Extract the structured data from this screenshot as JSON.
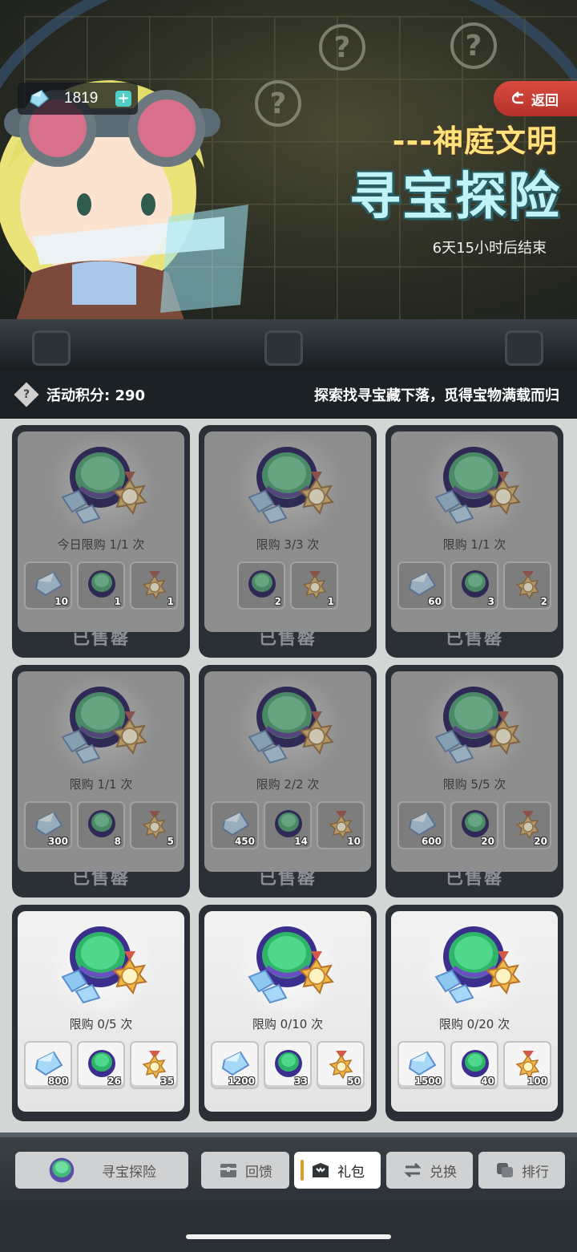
{
  "header": {
    "gem_count": "1819",
    "back_label": "返回",
    "event_subtitle": "---神庭文明",
    "event_title": "寻宝探险",
    "countdown": "6天15小时后结束"
  },
  "info_bar": {
    "score_label": "活动积分: 290",
    "slogan": "探索找寻宝藏下落，觅得宝物满载而归"
  },
  "bundles": [
    {
      "status": "soldout",
      "limit": "今日限购 1/1 次",
      "soldout_label": "已售罄",
      "items": [
        {
          "icon": "crystal-icon",
          "qty": "10"
        },
        {
          "icon": "compass-orb-icon",
          "qty": "1"
        },
        {
          "icon": "medal-icon",
          "qty": "1"
        }
      ]
    },
    {
      "status": "soldout",
      "limit": "限购 3/3 次",
      "soldout_label": "已售罄",
      "items": [
        {
          "icon": "compass-orb-icon",
          "qty": "2"
        },
        {
          "icon": "medal-icon",
          "qty": "1"
        }
      ]
    },
    {
      "status": "soldout",
      "limit": "限购 1/1 次",
      "soldout_label": "已售罄",
      "items": [
        {
          "icon": "crystal-icon",
          "qty": "60"
        },
        {
          "icon": "compass-orb-icon",
          "qty": "3"
        },
        {
          "icon": "medal-icon",
          "qty": "2"
        }
      ]
    },
    {
      "status": "soldout",
      "limit": "限购 1/1 次",
      "soldout_label": "已售罄",
      "items": [
        {
          "icon": "crystal-icon",
          "qty": "300"
        },
        {
          "icon": "compass-orb-icon",
          "qty": "8"
        },
        {
          "icon": "medal-icon",
          "qty": "5"
        }
      ]
    },
    {
      "status": "soldout",
      "limit": "限购 2/2 次",
      "soldout_label": "已售罄",
      "items": [
        {
          "icon": "crystal-icon",
          "qty": "450"
        },
        {
          "icon": "compass-orb-icon",
          "qty": "14"
        },
        {
          "icon": "medal-icon",
          "qty": "10"
        }
      ]
    },
    {
      "status": "soldout",
      "limit": "限购 5/5 次",
      "soldout_label": "已售罄",
      "items": [
        {
          "icon": "crystal-icon",
          "qty": "600"
        },
        {
          "icon": "compass-orb-icon",
          "qty": "20"
        },
        {
          "icon": "medal-icon",
          "qty": "20"
        }
      ]
    },
    {
      "status": "active",
      "limit": "限购 0/5 次",
      "items": [
        {
          "icon": "crystal-icon",
          "qty": "800"
        },
        {
          "icon": "compass-orb-icon",
          "qty": "26"
        },
        {
          "icon": "medal-icon",
          "qty": "35"
        }
      ]
    },
    {
      "status": "active",
      "limit": "限购 0/10 次",
      "items": [
        {
          "icon": "crystal-icon",
          "qty": "1200"
        },
        {
          "icon": "compass-orb-icon",
          "qty": "33"
        },
        {
          "icon": "medal-icon",
          "qty": "50"
        }
      ]
    },
    {
      "status": "active",
      "limit": "限购 0/20 次",
      "items": [
        {
          "icon": "crystal-icon",
          "qty": "1500"
        },
        {
          "icon": "compass-orb-icon",
          "qty": "40"
        },
        {
          "icon": "medal-icon",
          "qty": "100"
        }
      ]
    }
  ],
  "tabs": [
    {
      "label": "寻宝探险",
      "icon": "compass-orb-icon",
      "active": false
    },
    {
      "label": "回馈",
      "icon": "chest-icon",
      "active": false
    },
    {
      "label": "礼包",
      "icon": "gift-pack-icon",
      "active": true
    },
    {
      "label": "兑换",
      "icon": "exchange-icon",
      "active": false
    },
    {
      "label": "排行",
      "icon": "ranking-icon",
      "active": false
    }
  ],
  "colors": {
    "title_cyan": "#bff3f6",
    "subtitle_yellow": "#ffe37a",
    "back_red": "#c93b32",
    "tab_accent": "#e09a2a"
  }
}
